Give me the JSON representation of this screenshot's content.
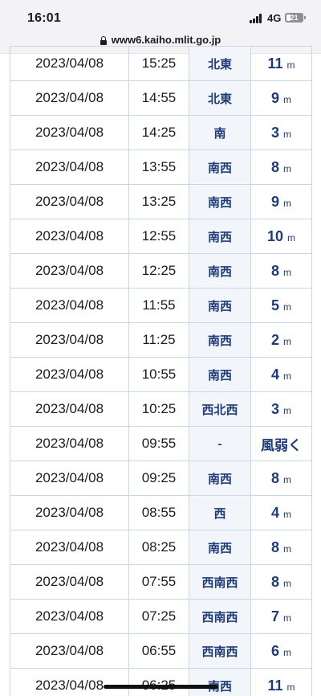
{
  "status_bar": {
    "time": "16:01",
    "network": "4G",
    "battery": "21"
  },
  "browser": {
    "url": "www6.kaiho.mlit.go.jp"
  },
  "observations": {
    "rows": [
      {
        "date": "2023/04/08",
        "time": "15:25",
        "direction": "北東",
        "wave_value": "11",
        "wave_unit": "m"
      },
      {
        "date": "2023/04/08",
        "time": "14:55",
        "direction": "北東",
        "wave_value": "9",
        "wave_unit": "m"
      },
      {
        "date": "2023/04/08",
        "time": "14:25",
        "direction": "南",
        "wave_value": "3",
        "wave_unit": "m"
      },
      {
        "date": "2023/04/08",
        "time": "13:55",
        "direction": "南西",
        "wave_value": "8",
        "wave_unit": "m"
      },
      {
        "date": "2023/04/08",
        "time": "13:25",
        "direction": "南西",
        "wave_value": "9",
        "wave_unit": "m"
      },
      {
        "date": "2023/04/08",
        "time": "12:55",
        "direction": "南西",
        "wave_value": "10",
        "wave_unit": "m"
      },
      {
        "date": "2023/04/08",
        "time": "12:25",
        "direction": "南西",
        "wave_value": "8",
        "wave_unit": "m"
      },
      {
        "date": "2023/04/08",
        "time": "11:55",
        "direction": "南西",
        "wave_value": "5",
        "wave_unit": "m"
      },
      {
        "date": "2023/04/08",
        "time": "11:25",
        "direction": "南西",
        "wave_value": "2",
        "wave_unit": "m"
      },
      {
        "date": "2023/04/08",
        "time": "10:55",
        "direction": "南西",
        "wave_value": "4",
        "wave_unit": "m"
      },
      {
        "date": "2023/04/08",
        "time": "10:25",
        "direction": "西北西",
        "wave_value": "3",
        "wave_unit": "m"
      },
      {
        "date": "2023/04/08",
        "time": "09:55",
        "direction": "-",
        "wave_text": "風弱く"
      },
      {
        "date": "2023/04/08",
        "time": "09:25",
        "direction": "南西",
        "wave_value": "8",
        "wave_unit": "m"
      },
      {
        "date": "2023/04/08",
        "time": "08:55",
        "direction": "西",
        "wave_value": "4",
        "wave_unit": "m"
      },
      {
        "date": "2023/04/08",
        "time": "08:25",
        "direction": "南西",
        "wave_value": "8",
        "wave_unit": "m"
      },
      {
        "date": "2023/04/08",
        "time": "07:55",
        "direction": "西南西",
        "wave_value": "8",
        "wave_unit": "m"
      },
      {
        "date": "2023/04/08",
        "time": "07:25",
        "direction": "西南西",
        "wave_value": "7",
        "wave_unit": "m"
      },
      {
        "date": "2023/04/08",
        "time": "06:55",
        "direction": "西南西",
        "wave_value": "6",
        "wave_unit": "m"
      },
      {
        "date": "2023/04/08",
        "time": "06:25",
        "direction": "南西",
        "wave_value": "11",
        "wave_unit": "m"
      }
    ]
  }
}
